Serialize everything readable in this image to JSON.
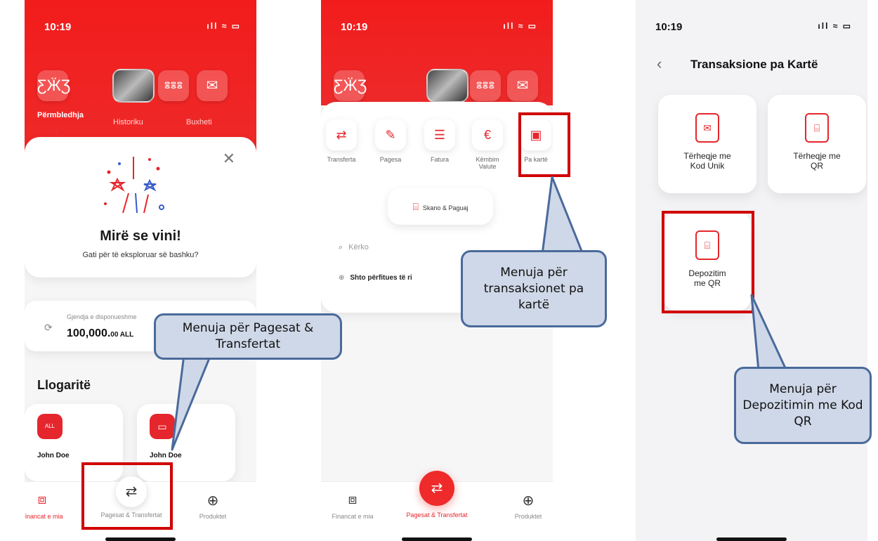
{
  "status": {
    "time": "10:19",
    "signal": "ıll ≈ ▭"
  },
  "screen1": {
    "tabs": [
      "Përmbledhja",
      "Historiku",
      "Buxheti"
    ],
    "welcome_title": "Mirë se vini!",
    "welcome_subtitle": "Gati për të eksploruar së bashku?",
    "balance_label": "Gjendja e disponueshme",
    "balance_value": "100,000.",
    "balance_decimals": "00 ALL",
    "accounts_title": "Llogaritë",
    "account_names": [
      "John Doe",
      "John Doe"
    ],
    "account_badge": "ALL",
    "nav": [
      "Financat e mia",
      "Pagesat & Transfertat",
      "Produktet"
    ]
  },
  "screen2": {
    "services": [
      "Transferta",
      "Pagesa",
      "Fatura",
      "Këmbim Valute",
      "Pa kartë"
    ],
    "scan_label": "Skano & Paguaj",
    "search_placeholder": "Kërko",
    "add_beneficiary": "Shto përfitues të ri",
    "nav": [
      "Financat e mia",
      "Pagesat & Transfertat",
      "Produktet"
    ]
  },
  "screen3": {
    "back": "‹",
    "title": "Transaksione pa Kartë",
    "tiles": [
      "Tërheqje me Kod Unik",
      "Tërheqje me QR",
      "Depozitim me QR"
    ]
  },
  "callouts": {
    "c1": "Menuja për Pagesat & Transfertat",
    "c2": "Menuja për transaksionet pa kartë",
    "c3": "Menuja për Depozitimin me Kod QR"
  },
  "colors": {
    "brand_red": "#ee2a2a",
    "highlight": "#d00000",
    "callout_fill": "#cfd8e8",
    "callout_border": "#4a6a9b"
  },
  "icons": [
    "butterfly-icon",
    "group-icon",
    "mail-icon",
    "close-icon",
    "transfer-icon",
    "payment-icon",
    "invoice-icon",
    "exchange-icon",
    "atm-icon",
    "qr-scan-icon",
    "search-icon",
    "plus-icon",
    "wallet-icon",
    "briefcase-icon",
    "back-chevron-icon"
  ]
}
